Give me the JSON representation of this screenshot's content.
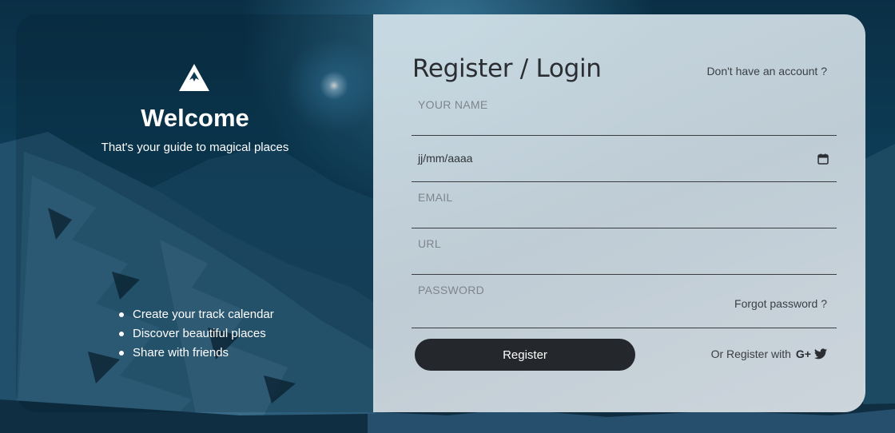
{
  "brand": {
    "logo_icon": "mountain-icon",
    "welcome": "Welcome",
    "tagline": "That's your guide to magical places"
  },
  "features": [
    "Create your track calendar",
    "Discover beautiful places",
    "Share with friends"
  ],
  "form": {
    "title": "Register / Login",
    "no_account_link": "Don't have an account ?",
    "name_placeholder": "YOUR NAME",
    "date_placeholder": "jj/mm/aaaa",
    "email_placeholder": "EMAIL",
    "url_placeholder": "URL",
    "password_placeholder": "PASSWORD",
    "forgot_password": "Forgot password ?",
    "register_button": "Register",
    "or_register_with": "Or Register with",
    "google_plus": "G+"
  },
  "colors": {
    "button_bg": "#24272b",
    "panel_bg": "#c8d6de",
    "text_dark": "#2a2d31"
  }
}
